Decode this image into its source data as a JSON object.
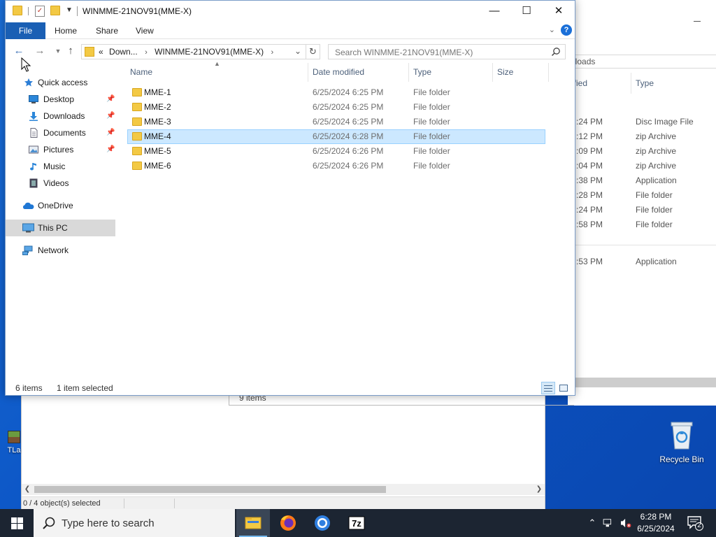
{
  "window": {
    "title": "WINMME-21NOV91(MME-X)",
    "controls": {
      "minimize": "—",
      "maximize": "☐",
      "close": "✕"
    }
  },
  "ribbon": {
    "tabs": [
      "File",
      "Home",
      "Share",
      "View"
    ]
  },
  "address": {
    "overflow": "«",
    "crumbs": [
      "Down...",
      "WINMME-21NOV91(MME-X)"
    ],
    "search_placeholder": "Search WINMME-21NOV91(MME-X)"
  },
  "nav_pane": {
    "items": [
      {
        "label": "Quick access",
        "icon": "star-icon",
        "pinned": false
      },
      {
        "label": "Desktop",
        "icon": "desktop-icon",
        "pinned": true
      },
      {
        "label": "Downloads",
        "icon": "download-icon",
        "pinned": true
      },
      {
        "label": "Documents",
        "icon": "documents-icon",
        "pinned": true
      },
      {
        "label": "Pictures",
        "icon": "pictures-icon",
        "pinned": true
      },
      {
        "label": "Music",
        "icon": "music-icon",
        "pinned": false
      },
      {
        "label": "Videos",
        "icon": "videos-icon",
        "pinned": false
      },
      {
        "label": "OneDrive",
        "icon": "onedrive-icon",
        "pinned": false
      },
      {
        "label": "This PC",
        "icon": "this-pc-icon",
        "pinned": false,
        "selected": true
      },
      {
        "label": "Network",
        "icon": "network-icon",
        "pinned": false
      }
    ]
  },
  "columns": [
    "Name",
    "Date modified",
    "Type",
    "Size"
  ],
  "files": [
    {
      "name": "MME-1",
      "date": "6/25/2024 6:25 PM",
      "type": "File folder",
      "size": ""
    },
    {
      "name": "MME-2",
      "date": "6/25/2024 6:25 PM",
      "type": "File folder",
      "size": ""
    },
    {
      "name": "MME-3",
      "date": "6/25/2024 6:25 PM",
      "type": "File folder",
      "size": ""
    },
    {
      "name": "MME-4",
      "date": "6/25/2024 6:28 PM",
      "type": "File folder",
      "size": "",
      "selected": true
    },
    {
      "name": "MME-5",
      "date": "6/25/2024 6:26 PM",
      "type": "File folder",
      "size": ""
    },
    {
      "name": "MME-6",
      "date": "6/25/2024 6:26 PM",
      "type": "File folder",
      "size": ""
    }
  ],
  "status": {
    "items": "6 items",
    "selected": "1 item selected"
  },
  "bg_window": {
    "address_fragment": "nloads",
    "col_modified": "ified",
    "col_type": "Type",
    "rows": [
      {
        "time": ":24 PM",
        "type": "Disc Image File"
      },
      {
        "time": ":12 PM",
        "type": "zip Archive"
      },
      {
        "time": ":09 PM",
        "type": "zip Archive"
      },
      {
        "time": ":04 PM",
        "type": "zip Archive"
      },
      {
        "time": ":38 PM",
        "type": "Application"
      },
      {
        "time": ":28 PM",
        "type": "File folder"
      },
      {
        "time": ":24 PM",
        "type": "File folder"
      },
      {
        "time": ":58 PM",
        "type": "File folder"
      },
      {
        "time": ":53 PM",
        "type": "Application"
      }
    ],
    "items_count": "9 items",
    "status": "0 / 4 object(s) selected"
  },
  "desktop": {
    "recycle_bin": "Recycle Bin",
    "tlauncher": "TLa"
  },
  "taskbar": {
    "search_placeholder": "Type here to search",
    "apps": [
      "file-explorer-icon",
      "firefox-icon",
      "chrome-icon",
      "7zip-icon"
    ],
    "sevenzip_label": "7z",
    "time": "6:28 PM",
    "date": "6/25/2024",
    "notifications": "2"
  },
  "colors": {
    "accent": "#1a5fb4",
    "selection": "#cce8ff",
    "folder": "#f3c944",
    "taskbar": "#1c2532"
  }
}
